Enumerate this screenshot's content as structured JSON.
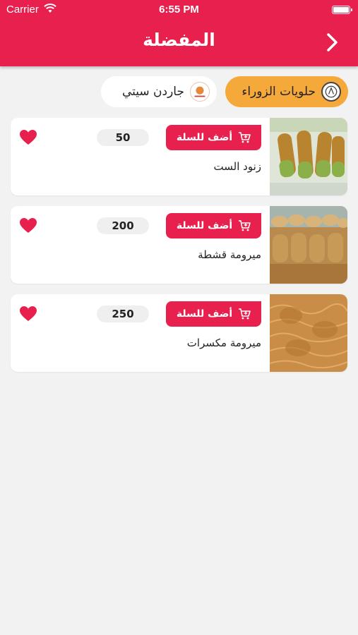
{
  "status_bar": {
    "carrier": "Carrier",
    "time": "6:55 PM"
  },
  "header": {
    "title": "المفضلة",
    "back_icon": "chevron-right-icon"
  },
  "colors": {
    "primary": "#e8204d",
    "chip_active": "#f6a93b",
    "background": "#f2f2f2"
  },
  "stores": [
    {
      "name": "حلويات الزوراء",
      "active": true
    },
    {
      "name": "جاردن سيتي",
      "active": false
    }
  ],
  "items": [
    {
      "name": "زنود الست",
      "price": "50",
      "add_label": "أضف للسلة",
      "favorite": true
    },
    {
      "name": "ميرومة قشطة",
      "price": "200",
      "add_label": "أضف للسلة",
      "favorite": true
    },
    {
      "name": "ميرومة مكسرات",
      "price": "250",
      "add_label": "أضف للسلة",
      "favorite": true
    }
  ]
}
